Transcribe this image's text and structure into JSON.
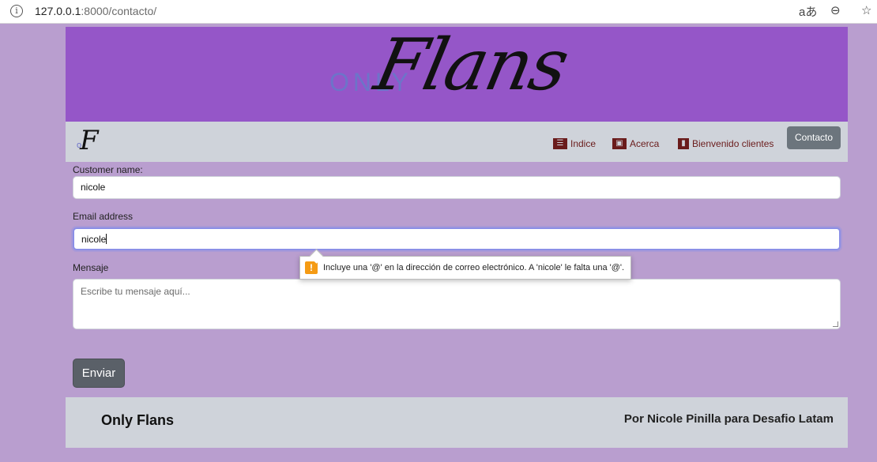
{
  "browser": {
    "url_host": "127.0.0.1",
    "url_rest": ":8000/contacto/",
    "icons": [
      "info-icon",
      "translate-icon",
      "zoom-out-icon",
      "star-icon"
    ]
  },
  "banner": {
    "logo_only": "ONLY",
    "logo_flans": "Flans"
  },
  "navbar": {
    "brand_o": "o",
    "brand_f": "F",
    "items": [
      {
        "label": "Indice",
        "icon": "list-indent-icon"
      },
      {
        "label": "Acerca",
        "icon": "id-card-icon"
      },
      {
        "label": "Bienvenido clientes",
        "icon": "door-open-icon"
      }
    ],
    "active": "Contacto"
  },
  "form": {
    "name_label": "Customer name:",
    "name_value": "nicole",
    "email_label": "Email address",
    "email_value": "nicole",
    "message_label": "Mensaje",
    "message_placeholder": "Escribe tu mensaje aquí...",
    "submit_label": "Enviar"
  },
  "validation": {
    "icon": "warning-icon",
    "message": "Incluye una '@' en la dirección de correo electrónico. A 'nicole' le falta una '@'."
  },
  "footer": {
    "brand": "Only Flans",
    "credit": "Por Nicole Pinilla para Desafio Latam"
  },
  "colors": {
    "page_bg": "#b99ecf",
    "banner_bg": "#9556c8",
    "nav_bg": "#cfd3da",
    "nav_link": "#6a1b1b",
    "button_bg": "#5a6068"
  }
}
